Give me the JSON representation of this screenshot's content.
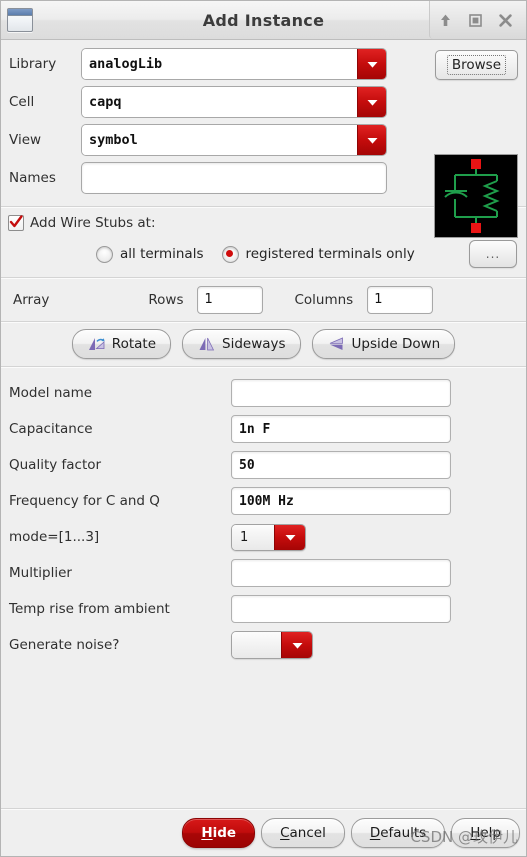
{
  "window": {
    "title": "Add Instance",
    "icon": "window-icon",
    "controls": [
      {
        "name": "shade-button",
        "icon": "arrow-up-icon"
      },
      {
        "name": "maximize-button",
        "icon": "square-icon"
      },
      {
        "name": "close-button",
        "icon": "close-x-icon"
      }
    ]
  },
  "top": {
    "library": {
      "label": "Library",
      "value": "analogLib"
    },
    "cell": {
      "label": "Cell",
      "value": "capq"
    },
    "view": {
      "label": "View",
      "value": "symbol"
    },
    "names": {
      "label": "Names",
      "value": "",
      "placeholder": ""
    },
    "browse_label": "Browse",
    "symbol_preview": "capq-symbol-preview"
  },
  "wire_stubs": {
    "checkbox_label": "Add Wire Stubs at:",
    "checked": true,
    "options": [
      {
        "label": "all terminals",
        "selected": false
      },
      {
        "label": "registered terminals only",
        "selected": true
      }
    ],
    "more_button_label": "..."
  },
  "array": {
    "label": "Array",
    "rows_label": "Rows",
    "rows_value": "1",
    "columns_label": "Columns",
    "columns_value": "1"
  },
  "orientation": {
    "rotate_label": "Rotate",
    "sideways_label": "Sideways",
    "upside_down_label": "Upside Down"
  },
  "params": [
    {
      "label": "Model name",
      "value": "",
      "type": "text"
    },
    {
      "label": "Capacitance",
      "value": "1n  F",
      "type": "text"
    },
    {
      "label": "Quality factor",
      "value": "50",
      "type": "text"
    },
    {
      "label": "Frequency for C and Q",
      "value": "100M  Hz",
      "type": "text"
    },
    {
      "label": "mode=[1...3]",
      "value": "1",
      "type": "combo"
    },
    {
      "label": "Multiplier",
      "value": "",
      "type": "text"
    },
    {
      "label": "Temp rise from ambient",
      "value": "",
      "type": "text"
    },
    {
      "label": "Generate noise?",
      "value": "",
      "type": "combo"
    }
  ],
  "footer": {
    "hide_label": "Hide",
    "cancel_label": "Cancel",
    "defaults_label": "Defaults",
    "help_label": "Help",
    "watermark": "CSDN @玫伊儿"
  },
  "colors": {
    "accent_red": "#c40c0c",
    "window_bg": "#efefef",
    "symbol_green": "#1f9e4b",
    "symbol_pin_red": "#e81414"
  }
}
